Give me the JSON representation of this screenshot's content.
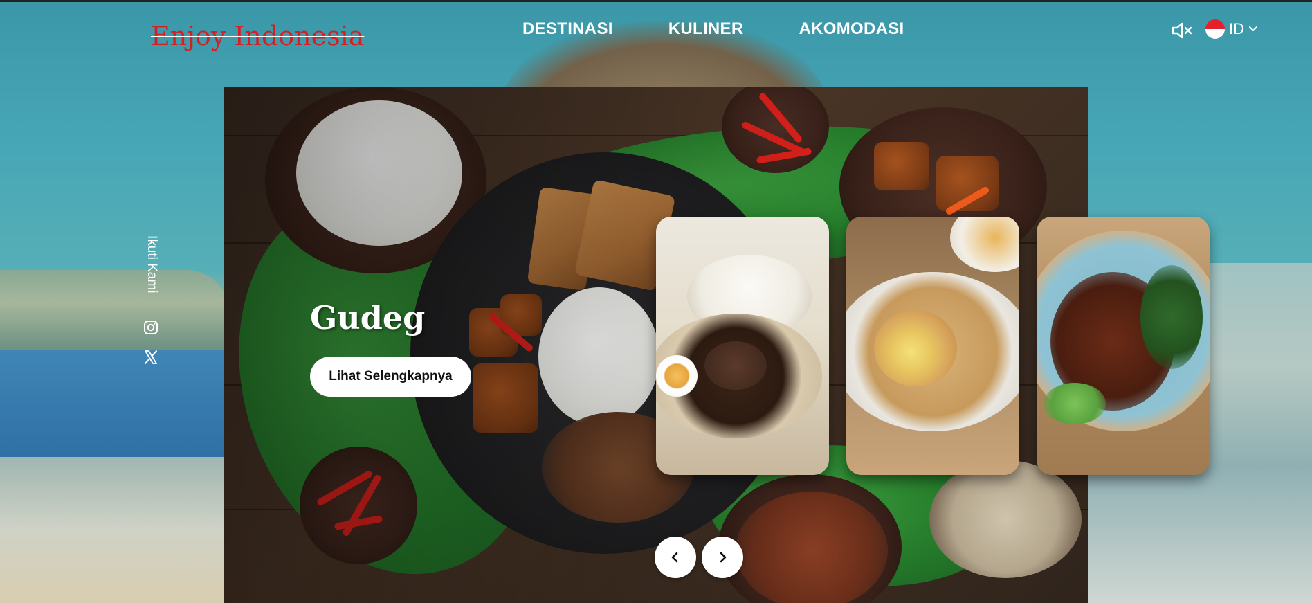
{
  "site": {
    "logo": "Enjoy Indonesia"
  },
  "nav": {
    "items": [
      {
        "label": "DESTINASI"
      },
      {
        "label": "KULINER"
      },
      {
        "label": "AKOMODASI"
      }
    ]
  },
  "header": {
    "language": "ID",
    "sound_icon": "speaker-muted-icon",
    "flag_icon": "indonesia-flag-icon"
  },
  "follow": {
    "label": "Ikuti Kami",
    "icons": [
      "instagram-icon",
      "x-twitter-icon"
    ]
  },
  "hero": {
    "title": "Gudeg",
    "cta_label": "Lihat Selengkapnya"
  },
  "cards": [
    {
      "icon": "food-card-rawon"
    },
    {
      "icon": "food-card-siomay"
    },
    {
      "icon": "food-card-grilled-meat"
    }
  ],
  "controls": {
    "prev_icon": "chevron-left-icon",
    "next_icon": "chevron-right-icon"
  },
  "colors": {
    "logo": "#d41f24",
    "nav_text": "#ffffff",
    "button_bg": "#ffffff",
    "button_text": "#111111"
  }
}
